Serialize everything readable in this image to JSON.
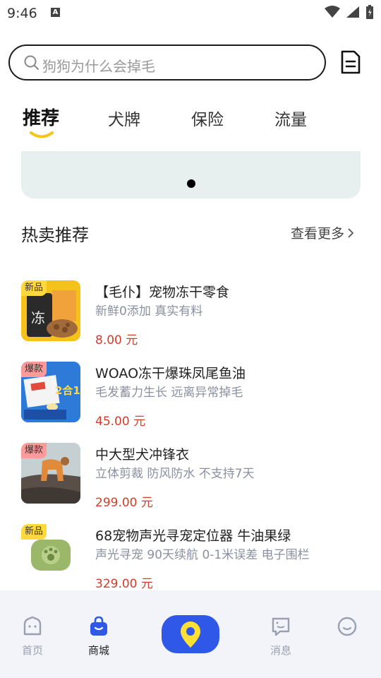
{
  "status": {
    "time": "9:46",
    "notif_icon": "A"
  },
  "search": {
    "placeholder": "狗狗为什么会掉毛"
  },
  "tabs": [
    {
      "label": "推荐",
      "active": true
    },
    {
      "label": "犬牌"
    },
    {
      "label": "保险"
    },
    {
      "label": "流量"
    }
  ],
  "section": {
    "title": "热卖推荐",
    "more": "查看更多"
  },
  "products": [
    {
      "badge": "新品",
      "badge_type": "new",
      "name": "【毛仆】宠物冻干零食",
      "desc": "新鲜0添加 真实有料",
      "price": "8.00 元"
    },
    {
      "badge": "爆款",
      "badge_type": "hot",
      "name": "WOAO冻干爆珠凤尾鱼油",
      "desc": "毛发蓄力生长 远离异常掉毛",
      "price": "45.00 元"
    },
    {
      "badge": "爆款",
      "badge_type": "hot",
      "name": "中大型犬冲锋衣",
      "desc": "立体剪裁 防风防水 不支持7天",
      "price": "299.00 元"
    },
    {
      "badge": "新品",
      "badge_type": "new",
      "name": "68宠物声光寻宠定位器 牛油果绿",
      "desc": "声光寻宠 90天续航 0-1米误差 电子围栏",
      "price": "329.00 元"
    }
  ],
  "nav": {
    "home": "首页",
    "shop": "商城",
    "message": "消息"
  },
  "colors": {
    "accent": "#2f58e8",
    "price": "#d63c2a",
    "tab_underline": "#f5c518"
  }
}
